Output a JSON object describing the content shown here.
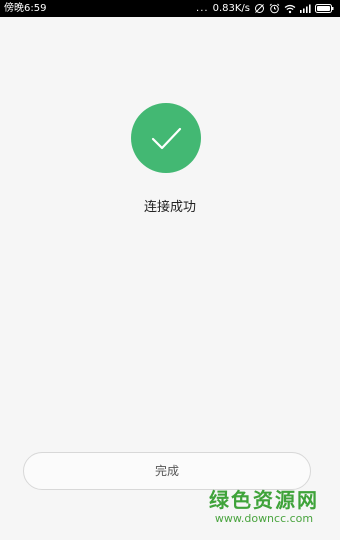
{
  "status_bar": {
    "time": "傍晚6:59",
    "dots": "...",
    "network_speed": "0.83K/s"
  },
  "status_icons": [
    "signal-off-icon",
    "alarm-icon",
    "wifi-icon",
    "cellular-signal-icon",
    "battery-icon"
  ],
  "main": {
    "success_icon": "checkmark-icon",
    "message": "连接成功"
  },
  "footer": {
    "done_label": "完成"
  },
  "watermark": {
    "title": "绿色资源网",
    "url": "www.downcc.com"
  },
  "colors": {
    "accent_green": "#43b873",
    "background": "#f6f6f6",
    "status_bar": "#000000",
    "watermark_green": "#3fa33a"
  }
}
